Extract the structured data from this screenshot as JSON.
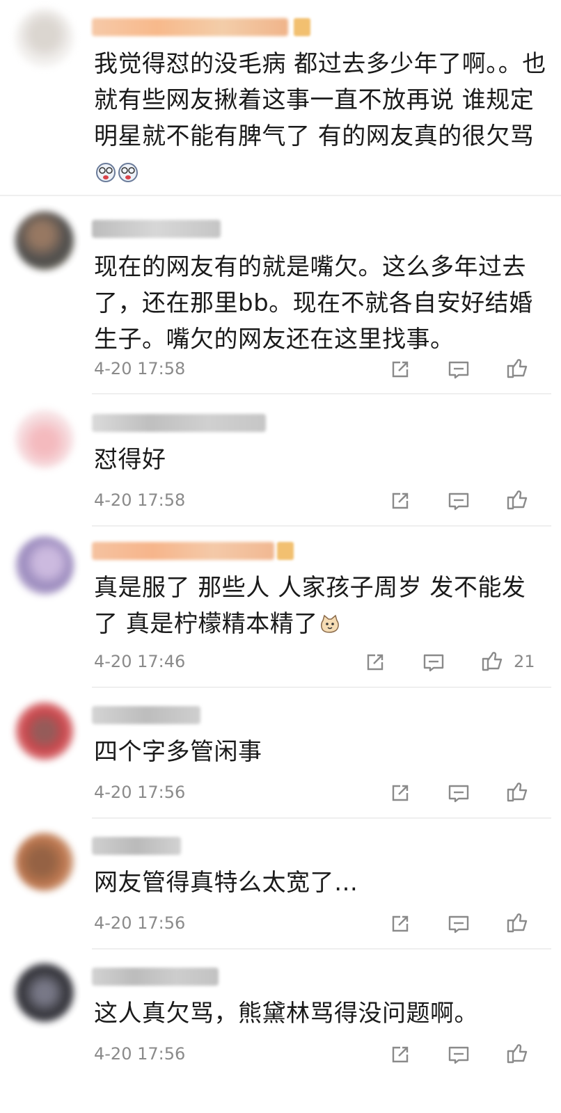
{
  "comments": [
    {
      "text": "我觉得怼的没毛病 都过去多少年了啊。。也就有些网友揪着这事一直不放再说 谁规定明星就不能有脾气了 有的网友真的很欠骂",
      "emoji": "dizzy-face-emoji ×2"
    },
    {
      "text": "现在的网友有的就是嘴欠。这么多年过去了，还在那里bb。现在不就各自安好结婚生子。嘴欠的网友还在这里找事。",
      "time": "4-20 17:58"
    },
    {
      "text": "怼得好",
      "time": "4-20 17:58"
    },
    {
      "text": "真是服了 那些人  人家孩子周岁 发不能发了 真是柠檬精本精了",
      "time": "4-20 17:46",
      "likes": "21",
      "emoji": "cat-emoji"
    },
    {
      "text": "四个字多管闲事",
      "time": "4-20 17:56"
    },
    {
      "text": "网友管得真特么太宽了…",
      "time": "4-20 17:56"
    },
    {
      "text": "这人真欠骂，熊黛林骂得没问题啊。",
      "time": "4-20 17:56"
    }
  ],
  "icons": {
    "share": "share-icon",
    "reply": "comment-icon",
    "like": "thumbs-up-icon"
  },
  "colors": {
    "text": "#1a1a1a",
    "meta": "#8a8a8a",
    "divider": "#efefef",
    "badge": "#f2c070"
  }
}
